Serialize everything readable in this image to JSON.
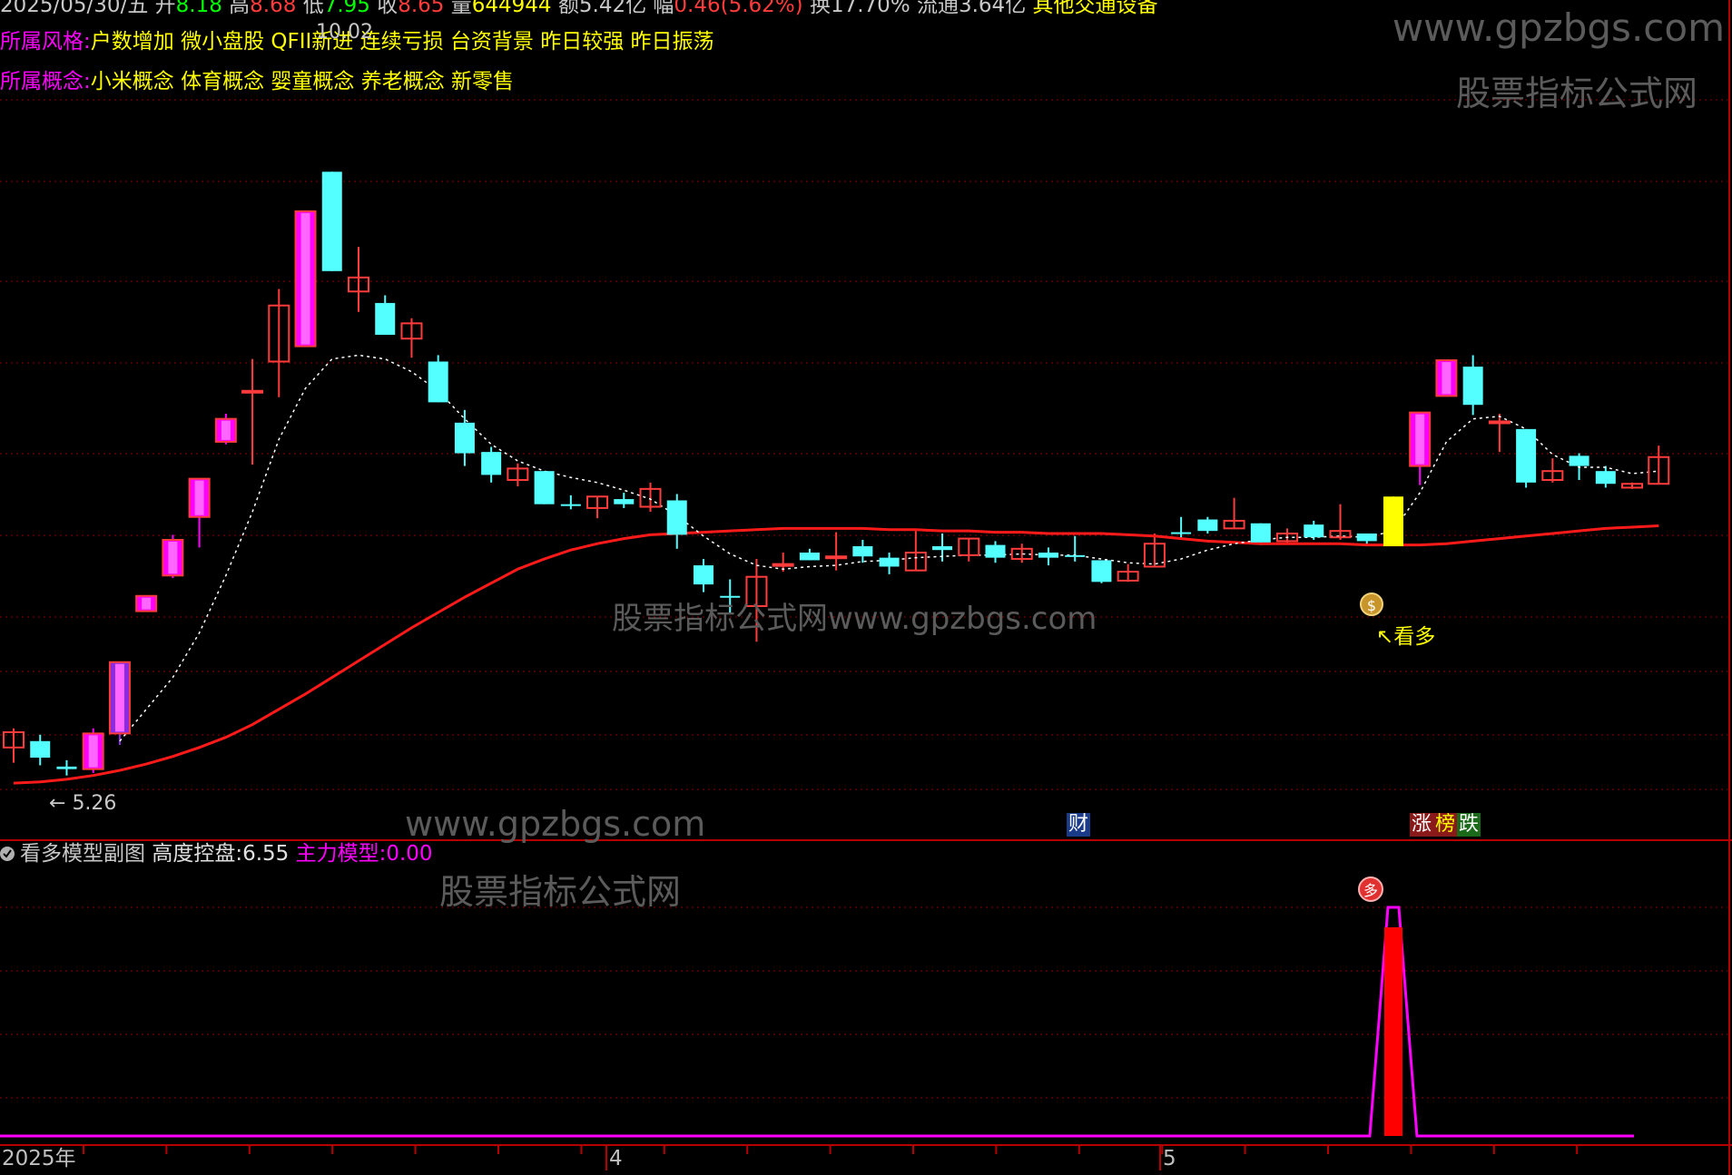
{
  "header": {
    "date": "2025/05/30/五",
    "open_label": "开",
    "open": "8.18",
    "high_label": "高",
    "high": "8.68",
    "low_label": "低",
    "low": "7.95",
    "close_label": "收",
    "close": "8.65",
    "volume_label": "量",
    "volume": "644944",
    "amount_label": "额",
    "amount": "5.42亿",
    "change_label": "幅",
    "change": "0.46(5.62%)",
    "turnover_label": "换",
    "turnover": "17.70%",
    "float_label": "流通",
    "float": "3.64亿",
    "industry": "其他交通设备"
  },
  "style_row": {
    "label": "所属风格:",
    "items": [
      "户数增加",
      "微小盘股",
      "QFII新进",
      "连续亏损",
      "台资背景",
      "昨日较强",
      "昨日振荡"
    ]
  },
  "concept_row": {
    "label": "所属概念:",
    "items": [
      "小米概念",
      "体育概念",
      "婴童概念",
      "养老概念",
      "新零售"
    ]
  },
  "annotations": {
    "low_price": "5.26",
    "high_price": "10.02",
    "signal": "看多"
  },
  "badges": {
    "finance": "财",
    "rise": "涨",
    "list": "榜",
    "fall": "跌"
  },
  "subchart": {
    "title": "看多模型副图",
    "height_label": "高度控盘:",
    "height_value": "6.55",
    "main_label": "主力模型:",
    "main_value": "0.00",
    "marker": "多"
  },
  "axis": {
    "year": "2025年",
    "month_4": "4",
    "month_5": "5"
  },
  "watermarks": {
    "url": "www.gpzbgs.com",
    "name": "股票指标公式网",
    "mid": "股票指标公式网www.gpzbgs.com"
  },
  "colors": {
    "up": "#ff3b3b",
    "down": "#54ffff",
    "boom": "#ff00ff",
    "ma": "#ff1a1a",
    "signal": "#ffff00",
    "grid": "#8b0000",
    "model_line": "#ff00ff",
    "model_fill": "#ff0000"
  },
  "chart_data": {
    "type": "candlestick",
    "price_range": [
      5.0,
      10.3
    ],
    "candles": [
      {
        "o": 5.5,
        "c": 5.62,
        "h": 5.65,
        "l": 5.38,
        "color": "up"
      },
      {
        "o": 5.55,
        "c": 5.42,
        "h": 5.6,
        "l": 5.36,
        "color": "down"
      },
      {
        "o": 5.35,
        "c": 5.33,
        "h": 5.4,
        "l": 5.28,
        "color": "down"
      },
      {
        "o": 5.33,
        "c": 5.61,
        "h": 5.65,
        "l": 5.3,
        "color": "boom"
      },
      {
        "o": 5.61,
        "c": 6.17,
        "h": 6.17,
        "l": 5.52,
        "color": "boom_purple"
      },
      {
        "o": 6.57,
        "c": 6.69,
        "h": 6.69,
        "l": 6.57,
        "color": "boom"
      },
      {
        "o": 6.85,
        "c": 7.13,
        "h": 7.17,
        "l": 6.83,
        "color": "boom"
      },
      {
        "o": 7.31,
        "c": 7.61,
        "h": 7.61,
        "l": 7.07,
        "color": "boom"
      },
      {
        "o": 7.9,
        "c": 8.08,
        "h": 8.12,
        "l": 7.88,
        "color": "boom"
      },
      {
        "o": 8.3,
        "c": 8.3,
        "h": 8.55,
        "l": 7.72,
        "color": "up"
      },
      {
        "o": 8.53,
        "c": 8.97,
        "h": 9.1,
        "l": 8.25,
        "color": "up"
      },
      {
        "o": 8.65,
        "c": 9.71,
        "h": 9.71,
        "l": 8.65,
        "color": "boom"
      },
      {
        "o": 10.02,
        "c": 9.24,
        "h": 10.02,
        "l": 9.24,
        "color": "down"
      },
      {
        "o": 9.08,
        "c": 9.19,
        "h": 9.43,
        "l": 8.92,
        "color": "up"
      },
      {
        "o": 8.99,
        "c": 8.74,
        "h": 9.05,
        "l": 8.74,
        "color": "down"
      },
      {
        "o": 8.71,
        "c": 8.83,
        "h": 8.87,
        "l": 8.56,
        "color": "up"
      },
      {
        "o": 8.53,
        "c": 8.21,
        "h": 8.58,
        "l": 8.21,
        "color": "down"
      },
      {
        "o": 8.05,
        "c": 7.81,
        "h": 8.15,
        "l": 7.71,
        "color": "down"
      },
      {
        "o": 7.82,
        "c": 7.64,
        "h": 7.86,
        "l": 7.58,
        "color": "down"
      },
      {
        "o": 7.6,
        "c": 7.69,
        "h": 7.73,
        "l": 7.55,
        "color": "up"
      },
      {
        "o": 7.67,
        "c": 7.41,
        "h": 7.67,
        "l": 7.41,
        "color": "down"
      },
      {
        "o": 7.41,
        "c": 7.41,
        "h": 7.48,
        "l": 7.37,
        "color": "down"
      },
      {
        "o": 7.38,
        "c": 7.47,
        "h": 7.47,
        "l": 7.3,
        "color": "up"
      },
      {
        "o": 7.45,
        "c": 7.41,
        "h": 7.5,
        "l": 7.38,
        "color": "down"
      },
      {
        "o": 7.39,
        "c": 7.53,
        "h": 7.58,
        "l": 7.35,
        "color": "up"
      },
      {
        "o": 7.44,
        "c": 7.17,
        "h": 7.49,
        "l": 7.06,
        "color": "down"
      },
      {
        "o": 6.93,
        "c": 6.78,
        "h": 6.98,
        "l": 6.72,
        "color": "down"
      },
      {
        "o": 6.69,
        "c": 6.69,
        "h": 6.82,
        "l": 6.55,
        "color": "down"
      },
      {
        "o": 6.61,
        "c": 6.84,
        "h": 6.98,
        "l": 6.33,
        "color": "up"
      },
      {
        "o": 6.94,
        "c": 6.94,
        "h": 7.03,
        "l": 6.88,
        "color": "up"
      },
      {
        "o": 7.03,
        "c": 6.97,
        "h": 7.06,
        "l": 6.97,
        "color": "down"
      },
      {
        "o": 7.0,
        "c": 7.0,
        "h": 7.19,
        "l": 6.89,
        "color": "up"
      },
      {
        "o": 7.08,
        "c": 7.0,
        "h": 7.13,
        "l": 6.95,
        "color": "down"
      },
      {
        "o": 6.99,
        "c": 6.92,
        "h": 7.03,
        "l": 6.86,
        "color": "down"
      },
      {
        "o": 6.89,
        "c": 7.03,
        "h": 7.2,
        "l": 6.89,
        "color": "up"
      },
      {
        "o": 7.08,
        "c": 7.05,
        "h": 7.18,
        "l": 6.96,
        "color": "down"
      },
      {
        "o": 7.01,
        "c": 7.14,
        "h": 7.14,
        "l": 6.96,
        "color": "up"
      },
      {
        "o": 7.09,
        "c": 6.99,
        "h": 7.12,
        "l": 6.95,
        "color": "down"
      },
      {
        "o": 6.98,
        "c": 7.06,
        "h": 7.1,
        "l": 6.95,
        "color": "up"
      },
      {
        "o": 7.03,
        "c": 6.99,
        "h": 7.07,
        "l": 6.93,
        "color": "down"
      },
      {
        "o": 7.01,
        "c": 7.01,
        "h": 7.16,
        "l": 6.96,
        "color": "down"
      },
      {
        "o": 6.97,
        "c": 6.8,
        "h": 6.97,
        "l": 6.79,
        "color": "down"
      },
      {
        "o": 6.81,
        "c": 6.88,
        "h": 6.94,
        "l": 6.8,
        "color": "up"
      },
      {
        "o": 6.92,
        "c": 7.1,
        "h": 7.18,
        "l": 6.92,
        "color": "up"
      },
      {
        "o": 7.19,
        "c": 7.19,
        "h": 7.31,
        "l": 7.13,
        "color": "down"
      },
      {
        "o": 7.29,
        "c": 7.2,
        "h": 7.31,
        "l": 7.18,
        "color": "down"
      },
      {
        "o": 7.22,
        "c": 7.28,
        "h": 7.46,
        "l": 7.22,
        "color": "up"
      },
      {
        "o": 7.26,
        "c": 7.11,
        "h": 7.26,
        "l": 7.09,
        "color": "down"
      },
      {
        "o": 7.12,
        "c": 7.18,
        "h": 7.22,
        "l": 7.1,
        "color": "up"
      },
      {
        "o": 7.25,
        "c": 7.15,
        "h": 7.28,
        "l": 7.13,
        "color": "down"
      },
      {
        "o": 7.15,
        "c": 7.2,
        "h": 7.41,
        "l": 7.13,
        "color": "up"
      },
      {
        "o": 7.18,
        "c": 7.12,
        "h": 7.18,
        "l": 7.08,
        "color": "down"
      },
      {
        "o": 7.08,
        "c": 7.47,
        "h": 7.47,
        "l": 7.08,
        "color": "signal"
      },
      {
        "o": 7.71,
        "c": 8.13,
        "h": 8.13,
        "l": 7.56,
        "color": "boom"
      },
      {
        "o": 8.26,
        "c": 8.54,
        "h": 8.54,
        "l": 8.26,
        "color": "boom"
      },
      {
        "o": 8.49,
        "c": 8.19,
        "h": 8.58,
        "l": 8.11,
        "color": "down"
      },
      {
        "o": 8.06,
        "c": 8.06,
        "h": 8.12,
        "l": 7.82,
        "color": "up"
      },
      {
        "o": 8.0,
        "c": 7.58,
        "h": 8.0,
        "l": 7.54,
        "color": "down"
      },
      {
        "o": 7.6,
        "c": 7.67,
        "h": 7.77,
        "l": 7.58,
        "color": "up"
      },
      {
        "o": 7.79,
        "c": 7.71,
        "h": 7.81,
        "l": 7.6,
        "color": "down"
      },
      {
        "o": 7.67,
        "c": 7.57,
        "h": 7.71,
        "l": 7.54,
        "color": "down"
      },
      {
        "o": 7.54,
        "c": 7.57,
        "h": 7.58,
        "l": 7.53,
        "color": "up"
      },
      {
        "o": 7.57,
        "c": 7.78,
        "h": 7.87,
        "l": 7.57,
        "color": "up"
      }
    ],
    "ma_long": [
      5.22,
      5.23,
      5.25,
      5.28,
      5.32,
      5.37,
      5.43,
      5.5,
      5.58,
      5.68,
      5.8,
      5.92,
      6.05,
      6.18,
      6.31,
      6.44,
      6.56,
      6.68,
      6.79,
      6.9,
      6.98,
      7.05,
      7.1,
      7.14,
      7.17,
      7.18,
      7.19,
      7.2,
      7.21,
      7.22,
      7.22,
      7.22,
      7.22,
      7.21,
      7.21,
      7.2,
      7.2,
      7.19,
      7.19,
      7.18,
      7.18,
      7.18,
      7.17,
      7.16,
      7.14,
      7.12,
      7.11,
      7.1,
      7.1,
      7.1,
      7.1,
      7.09,
      7.09,
      7.09,
      7.1,
      7.12,
      7.14,
      7.16,
      7.18,
      7.2,
      7.22,
      7.23,
      7.24
    ],
    "ma_short": [
      null,
      null,
      null,
      null,
      5.55,
      5.8,
      6.05,
      6.4,
      6.85,
      7.35,
      7.92,
      8.32,
      8.55,
      8.58,
      8.55,
      8.45,
      8.3,
      8.08,
      7.88,
      7.75,
      7.67,
      7.62,
      7.58,
      7.52,
      7.45,
      7.32,
      7.16,
      7.02,
      6.93,
      6.9,
      6.92,
      6.93,
      6.96,
      6.97,
      6.99,
      7.0,
      7.01,
      7.01,
      7.02,
      7.01,
      7.01,
      6.98,
      6.95,
      6.94,
      6.98,
      7.05,
      7.1,
      7.13,
      7.15,
      7.15,
      7.16,
      7.15,
      7.2,
      7.5,
      7.9,
      8.08,
      8.1,
      8.0,
      7.8,
      7.7,
      7.7,
      7.65,
      7.67
    ],
    "model_index": 52
  }
}
